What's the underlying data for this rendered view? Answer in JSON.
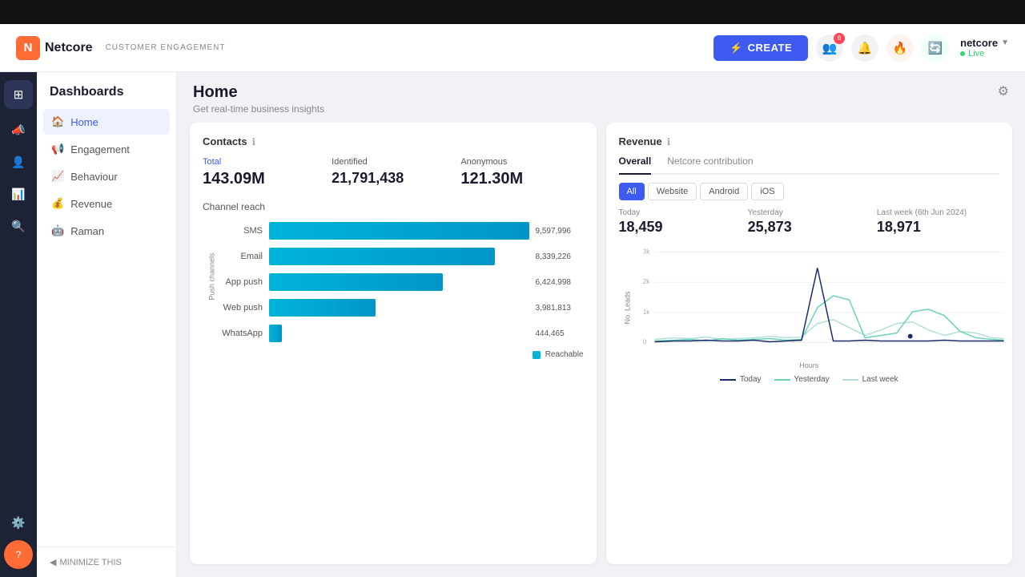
{
  "app": {
    "logo_letter": "N",
    "logo_name": "Netcore",
    "nav_tag": "CUSTOMER ENGAGEMENT",
    "live_status": "Live"
  },
  "header": {
    "create_label": "CREATE",
    "user_name": "netcore",
    "user_badge_count": "6",
    "icons": {
      "people": "👥",
      "bell": "🔔",
      "fire": "🔥",
      "refresh": "🔄"
    }
  },
  "sidebar": {
    "title": "Dashboards",
    "items": [
      {
        "id": "home",
        "label": "Home",
        "active": true
      },
      {
        "id": "engagement",
        "label": "Engagement",
        "active": false
      },
      {
        "id": "behaviour",
        "label": "Behaviour",
        "active": false
      },
      {
        "id": "revenue",
        "label": "Revenue",
        "active": false
      },
      {
        "id": "raman",
        "label": "Raman",
        "active": false
      }
    ],
    "minimize_label": "MINIMIZE THIS"
  },
  "page": {
    "title": "Home",
    "subtitle": "Get real-time business insights"
  },
  "contacts": {
    "section_title": "Contacts",
    "total_label": "Total",
    "total_value": "143.09M",
    "identified_label": "Identified",
    "identified_value": "21,791,438",
    "anonymous_label": "Anonymous",
    "anonymous_value": "121.30M",
    "channel_reach_title": "Channel reach",
    "channels": [
      {
        "name": "SMS",
        "value": 9597996,
        "display": "9,597,996",
        "pct": 100
      },
      {
        "name": "Email",
        "value": 8339226,
        "display": "8,339,226",
        "pct": 87
      },
      {
        "name": "App push",
        "value": 6424998,
        "display": "6,424,998",
        "pct": 67
      },
      {
        "name": "Web push",
        "value": 3981813,
        "display": "3,981,813",
        "pct": 41
      },
      {
        "name": "WhatsApp",
        "value": 444465,
        "display": "444,465",
        "pct": 5
      }
    ],
    "legend_label": "Reachable",
    "y_axis_label": "Push channels"
  },
  "revenue": {
    "section_title": "Revenue",
    "tabs": [
      "Overall",
      "Netcore contribution"
    ],
    "active_tab": "Overall",
    "platform_tabs": [
      "All",
      "Website",
      "Android",
      "iOS"
    ],
    "active_platform": "All",
    "today_label": "Today",
    "today_value": "18,459",
    "yesterday_label": "Yesterday",
    "yesterday_value": "25,873",
    "last_week_label": "Last week (6th Jun 2024)",
    "last_week_value": "18,971",
    "chart": {
      "y_max": 3000,
      "y_labels": [
        "3k",
        "2k",
        "1k",
        "0"
      ],
      "x_label": "Hours",
      "y_axis_label": "No. Leads"
    },
    "chart_legend": [
      "Today",
      "Yesterday",
      "Last week"
    ]
  },
  "rail_items": [
    {
      "id": "dashboard",
      "icon": "⊞",
      "active": true
    },
    {
      "id": "campaigns",
      "icon": "📣",
      "active": false
    },
    {
      "id": "users",
      "icon": "👤",
      "active": false
    },
    {
      "id": "analytics",
      "icon": "📊",
      "active": false
    },
    {
      "id": "search",
      "icon": "🔍",
      "active": false
    }
  ],
  "rail_bottom": [
    {
      "id": "settings",
      "icon": "⚙️"
    },
    {
      "id": "help",
      "icon": "❓"
    }
  ]
}
